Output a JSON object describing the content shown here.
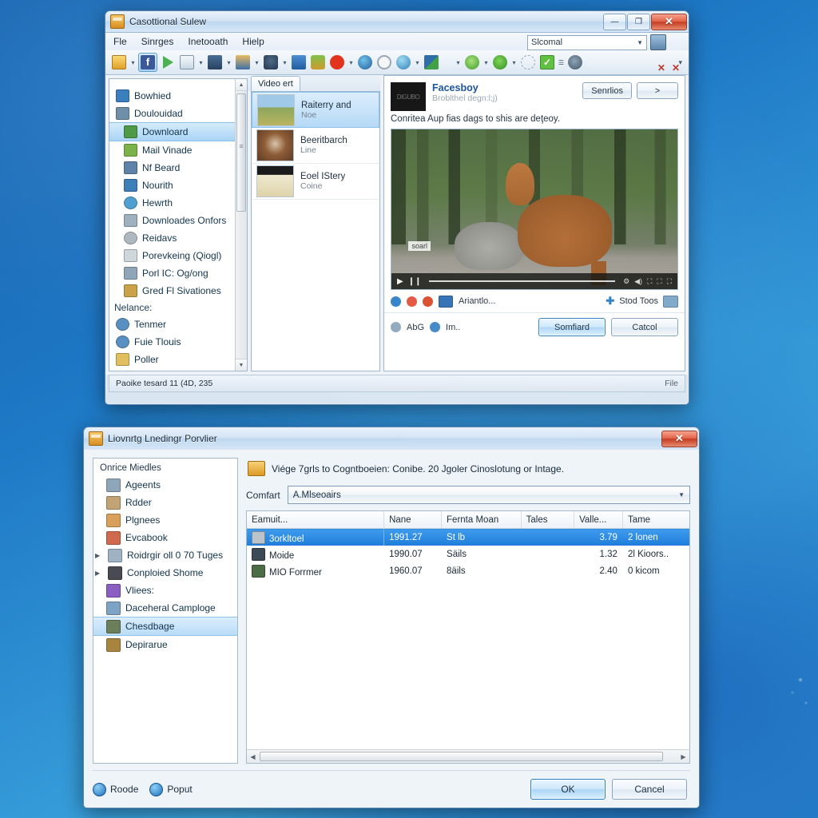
{
  "main_window": {
    "title": "Casottional Sulew",
    "title_icon": "app-icon",
    "window_buttons": {
      "minimize": "—",
      "maximize": "❐",
      "close": "✕"
    },
    "menu": [
      "Fle",
      "Sinrges",
      "Inetooath",
      "Hielp"
    ],
    "search": {
      "value": "Slcomal",
      "caret": "▼"
    },
    "tabstrip": {
      "tab_label": "Video ert",
      "close1": "✕",
      "close2": "✕"
    },
    "sidebar": {
      "items": [
        {
          "label": "Bowhied",
          "color": "#3c7fbe",
          "selected": false,
          "indent": false
        },
        {
          "label": "Doulouidad",
          "color": "#6f8fa8",
          "selected": false,
          "indent": false
        },
        {
          "label": "Downloard",
          "color": "#4f9a46",
          "selected": true,
          "indent": true
        },
        {
          "label": "Mail Vinade",
          "color": "#7bb34a",
          "selected": false,
          "indent": true
        },
        {
          "label": "Nf Beard",
          "color": "#5d83a8",
          "selected": false,
          "indent": true
        },
        {
          "label": "Nourith",
          "color": "#3f7fb9",
          "selected": false,
          "indent": true
        },
        {
          "label": "Hewrth",
          "color": "#4f9fd0",
          "selected": false,
          "indent": true
        },
        {
          "label": "Downloades Onfors",
          "color": "#9fb0bf",
          "selected": false,
          "indent": true
        },
        {
          "label": "Reidavs",
          "color": "#b0b8bf",
          "selected": false,
          "indent": true
        },
        {
          "label": "Porevkeing (Qiogl)",
          "color": "#cfd6dc",
          "selected": false,
          "indent": true
        },
        {
          "label": "Porl IC: Og/ong",
          "color": "#8fa6b8",
          "selected": false,
          "indent": true
        },
        {
          "label": "Gred Fl Sivationes",
          "color": "#c9a24a",
          "selected": false,
          "indent": true
        }
      ],
      "section_label": "Nelance:",
      "section_items": [
        {
          "label": "Tenmer",
          "color": "#5a8fc2"
        },
        {
          "label": "Fuie Tlouis",
          "color": "#5a8fc2"
        },
        {
          "label": "Poller",
          "color": "#e2bf5e"
        }
      ],
      "scroll_up": "▲",
      "scroll_down": "▼"
    },
    "media_list": [
      {
        "title": "Raiterry and",
        "subtitle": "Noe",
        "thumb": "#8fae6a",
        "selected": true
      },
      {
        "title": "Beeritbarch",
        "subtitle": "Line",
        "thumb": "#7a4a2e",
        "selected": false
      },
      {
        "title": "Eoel IStery",
        "subtitle": "Coine",
        "thumb": "#e8e0c2",
        "selected": false
      }
    ],
    "detail": {
      "logo_text": "DIGUBO",
      "title": "Facesboy",
      "subtitle": "Broblthel degn:l;j)",
      "button_services": "Senrlios",
      "button_next": ">",
      "description": "Conritea Aup fias dags to shis are deţeoy.",
      "video": {
        "watermark": "soarl",
        "play": "▶",
        "pause": "❙❙",
        "icons": [
          "⚙",
          "◀)",
          "⛶",
          "⛶",
          "⛶"
        ]
      },
      "actions": {
        "label": "Ariantlo...",
        "add_label": "Stod Toos",
        "add_plus": "✚"
      },
      "footer": {
        "item1": "AbG",
        "item2": "Im..",
        "confirm": "Somfiard",
        "cancel": "Catcol"
      }
    },
    "statusbar": {
      "left": "Paoike tesard 11 (4D, 235",
      "right": "File"
    }
  },
  "dialog": {
    "title": "Liovnrtg Lnedingr Porvlier",
    "close": "✕",
    "tree": {
      "header": "Onrice Miedles",
      "items": [
        {
          "label": "Ageents",
          "color": "#8fa6b8",
          "expander": "",
          "selected": false
        },
        {
          "label": "Rdder",
          "color": "#c2a376",
          "expander": "",
          "selected": false
        },
        {
          "label": "Plgnees",
          "color": "#d9a05b",
          "expander": "",
          "selected": false
        },
        {
          "label": "Evcabook",
          "color": "#d06a4f",
          "expander": "",
          "selected": false
        },
        {
          "label": "Roidrgir oll 0 70 Tuges",
          "color": "#9fb3c4",
          "expander": "▶",
          "selected": false
        },
        {
          "label": "Conploied Shome",
          "color": "#4a4a52",
          "expander": "▶",
          "selected": false
        },
        {
          "label": "Vliees:",
          "color": "#8a5ec2",
          "expander": "",
          "selected": false
        },
        {
          "label": "Daceheral Camploge",
          "color": "#7da4c4",
          "expander": "",
          "selected": false
        },
        {
          "label": "Chesdbage",
          "color": "#6b7f5a",
          "expander": "",
          "selected": true
        },
        {
          "label": "Depirarue",
          "color": "#a8853f",
          "expander": "",
          "selected": false
        }
      ]
    },
    "instruction": "Viége 7grls to Cogntboeien: Conibe. 20 Jgoler Cinoslotung or Intage.",
    "combo": {
      "label": "Comfart",
      "value": "A.Mlseoairs",
      "caret": "▼"
    },
    "table": {
      "columns": [
        "Eamuit...",
        "Nane",
        "Fernta Moan",
        "Tales",
        "Valle...",
        "Tame"
      ],
      "rows": [
        {
          "icon": "#b9c4cd",
          "cells": [
            "3orkltoel",
            "1991.27",
            "St lb",
            "",
            "3.79",
            "2 lonen"
          ],
          "selected": true
        },
        {
          "icon": "#3c4a55",
          "cells": [
            "Moide",
            "1990.07",
            "Säils",
            "",
            "1.32",
            "2l Kioors.."
          ],
          "selected": false
        },
        {
          "icon": "#4d6b45",
          "cells": [
            "MIO Forrmer",
            "1960.07",
            "8äils",
            "",
            "2.40",
            "0 kicom"
          ],
          "selected": false
        }
      ]
    },
    "hscroll": {
      "left": "◀",
      "right": "▶"
    },
    "footer": {
      "link1": "Roode",
      "link2": "Poput",
      "ok": "OK",
      "cancel": "Cancel"
    }
  }
}
